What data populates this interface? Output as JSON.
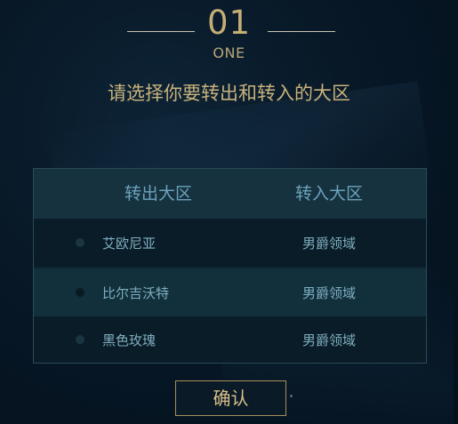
{
  "step": {
    "number": "01",
    "word": "ONE"
  },
  "instruction": "请选择你要转出和转入的大区",
  "table": {
    "columns": [
      "转出大区",
      "转入大区"
    ],
    "rows": [
      {
        "from": "艾欧尼亚",
        "to": "男爵领域"
      },
      {
        "from": "比尔吉沃特",
        "to": "男爵领域"
      },
      {
        "from": "黑色玫瑰",
        "to": "男爵领域"
      }
    ]
  },
  "confirm_label": "确认",
  "colors": {
    "gold": "#c5ae76",
    "header_text": "#6aa2bb",
    "row_text": "#7eaebf",
    "background": "#081827"
  }
}
